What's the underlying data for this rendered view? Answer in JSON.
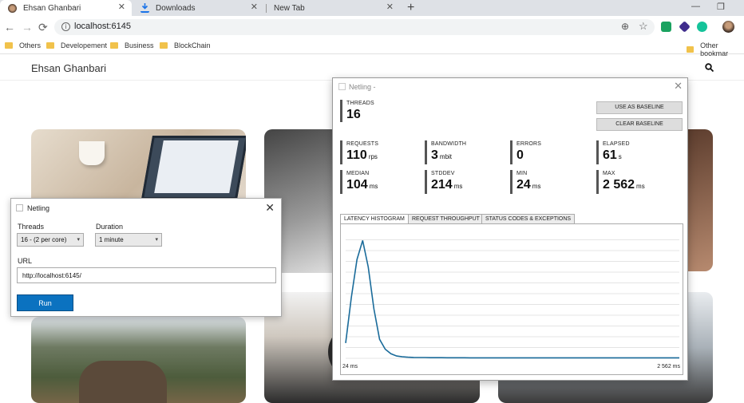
{
  "browser": {
    "tabs": [
      {
        "title": "Ehsan Ghanbari"
      },
      {
        "title": "Downloads"
      },
      {
        "title": "New Tab"
      }
    ],
    "new_tab": "+",
    "close_glyph": "✕",
    "url": "localhost:6145",
    "bookmarks": [
      "Others",
      "Developement",
      "Business",
      "BlockChain"
    ],
    "other_bookmarks": "Other bookmar"
  },
  "site": {
    "title": "Ehsan Ghanbari",
    "search_icon": "search-icon"
  },
  "netling_dialog": {
    "title": "Netling",
    "threads_label": "Threads",
    "threads_value": "16 - (2 per core)",
    "duration_label": "Duration",
    "duration_value": "1 minute",
    "url_label": "URL",
    "url_value": "http://localhost:6145/",
    "run_label": "Run"
  },
  "netling_results": {
    "title": "Netling -",
    "threads": {
      "label": "THREADS",
      "value": "16"
    },
    "use_baseline": "USE AS BASELINE",
    "clear_baseline": "CLEAR BASELINE",
    "stats": [
      {
        "label": "REQUESTS",
        "value": "110",
        "unit": "rps"
      },
      {
        "label": "BANDWIDTH",
        "value": "3",
        "unit": "mbit"
      },
      {
        "label": "ERRORS",
        "value": "0",
        "unit": ""
      },
      {
        "label": "ELAPSED",
        "value": "61",
        "unit": "s"
      },
      {
        "label": "MEDIAN",
        "value": "104",
        "unit": "ms"
      },
      {
        "label": "STDDEV",
        "value": "214",
        "unit": "ms"
      },
      {
        "label": "MIN",
        "value": "24",
        "unit": "ms"
      },
      {
        "label": "MAX",
        "value": "2 562",
        "unit": "ms"
      }
    ],
    "tabs": [
      "LATENCY HISTOGRAM",
      "REQUEST THROUGHPUT",
      "STATUS CODES & EXCEPTIONS"
    ],
    "x_min_label": "24 ms",
    "x_max_label": "2 562 ms"
  },
  "chart_data": {
    "type": "line",
    "title": "",
    "xlabel": "",
    "ylabel": "",
    "x_range": [
      24,
      2562
    ],
    "color": "#1a6b9a",
    "grid": true,
    "values": [
      20,
      80,
      130,
      155,
      120,
      65,
      25,
      12,
      6,
      3,
      2,
      1.5,
      1.2,
      1,
      1,
      0.8,
      0.8,
      0.8,
      0.7,
      0.7,
      0.7,
      0.7,
      0.6,
      0.6,
      0.6,
      0.6,
      0.6,
      0.6,
      0.6,
      0.6,
      0.6,
      0.6,
      0.6,
      0.6,
      0.6,
      0.6,
      0.6,
      0.6,
      0.6,
      0.6,
      0.6,
      0.6,
      0.6,
      0.6,
      0.6,
      0.6,
      0.6,
      0.6,
      0.6,
      0.6,
      0.6,
      0.6,
      0.6,
      0.6,
      0.6,
      0.6,
      0.6,
      0.6,
      0.6,
      0.6
    ],
    "ylim": [
      0,
      170
    ]
  }
}
